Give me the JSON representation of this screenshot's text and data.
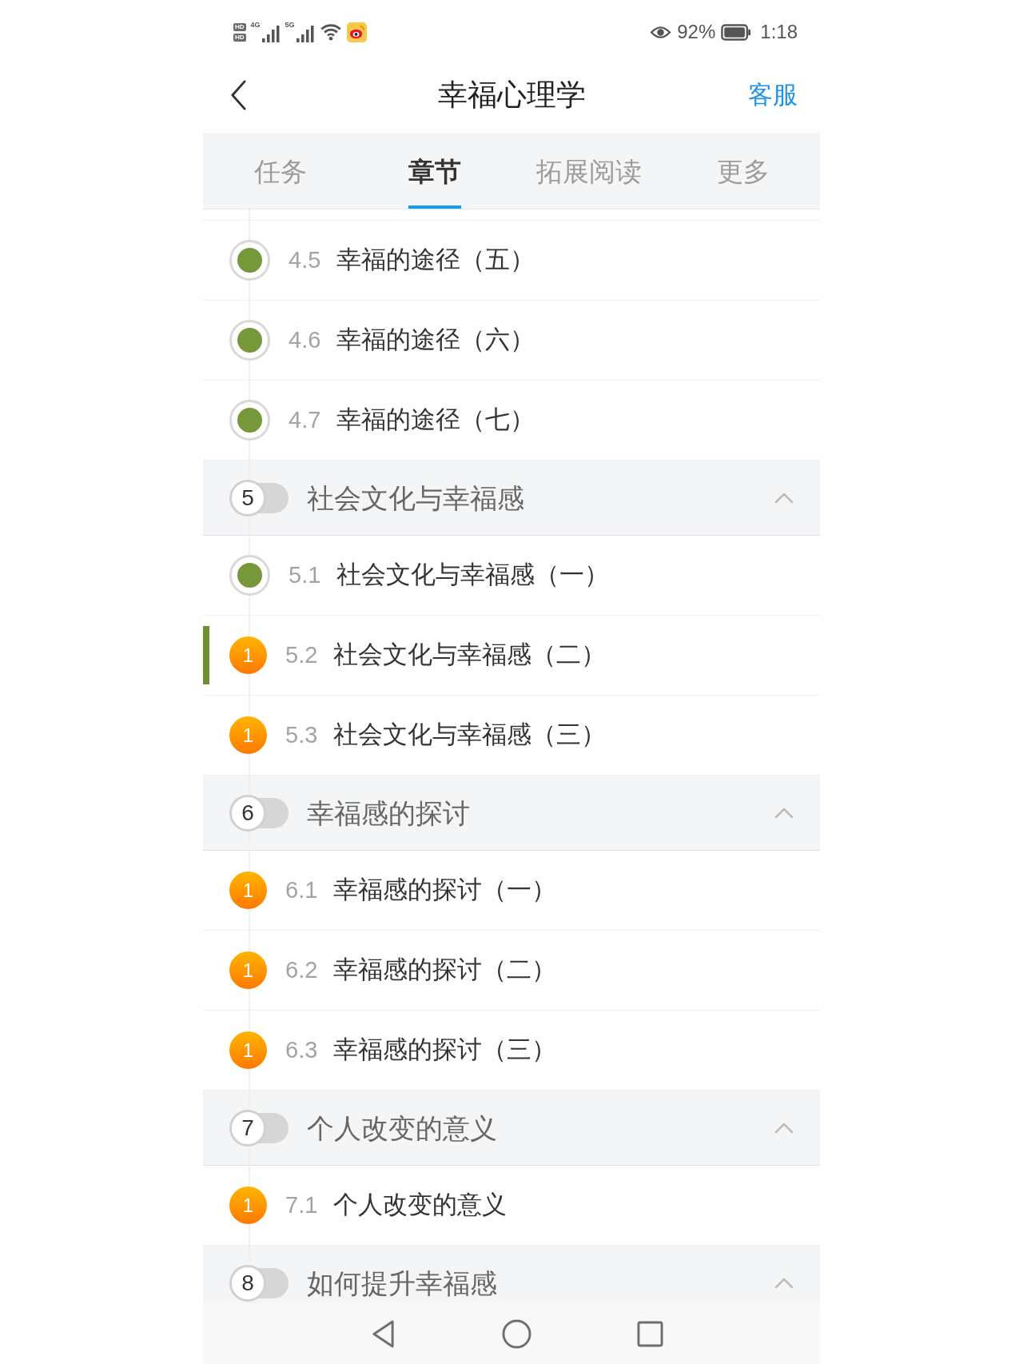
{
  "status_bar": {
    "sim_labels": [
      "HD",
      "HD"
    ],
    "network_types": [
      "4G",
      "5G"
    ],
    "battery": "92%",
    "time": "1:18"
  },
  "header": {
    "title": "幸福心理学",
    "action": "客服"
  },
  "tabs": [
    {
      "label": "任务",
      "selected": false
    },
    {
      "label": "章节",
      "selected": true
    },
    {
      "label": "拓展阅读",
      "selected": false
    },
    {
      "label": "更多",
      "selected": false
    }
  ],
  "sections": [
    {
      "children": [
        {
          "number": "4.5",
          "title": "幸福的途径（五）",
          "kind": "done",
          "selected": false
        },
        {
          "number": "4.6",
          "title": "幸福的途径（六）",
          "kind": "done",
          "selected": false
        },
        {
          "number": "4.7",
          "title": "幸福的途径（七）",
          "kind": "done",
          "selected": false
        }
      ]
    },
    {
      "number": "5",
      "title": "社会文化与幸福感",
      "expanded": true,
      "children": [
        {
          "number": "5.1",
          "title": "社会文化与幸福感（一）",
          "kind": "done",
          "selected": false
        },
        {
          "number": "5.2",
          "title": "社会文化与幸福感（二）",
          "kind": "pending",
          "badge": "1",
          "selected": true
        },
        {
          "number": "5.3",
          "title": "社会文化与幸福感（三）",
          "kind": "pending",
          "badge": "1",
          "selected": false
        }
      ]
    },
    {
      "number": "6",
      "title": "幸福感的探讨",
      "expanded": true,
      "children": [
        {
          "number": "6.1",
          "title": "幸福感的探讨（一）",
          "kind": "pending",
          "badge": "1",
          "selected": false
        },
        {
          "number": "6.2",
          "title": "幸福感的探讨（二）",
          "kind": "pending",
          "badge": "1",
          "selected": false
        },
        {
          "number": "6.3",
          "title": "幸福感的探讨（三）",
          "kind": "pending",
          "badge": "1",
          "selected": false
        }
      ]
    },
    {
      "number": "7",
      "title": "个人改变的意义",
      "expanded": true,
      "children": [
        {
          "number": "7.1",
          "title": "个人改变的意义",
          "kind": "pending",
          "badge": "1",
          "selected": false
        }
      ]
    },
    {
      "number": "8",
      "title": "如何提升幸福感",
      "expanded": true
    }
  ]
}
